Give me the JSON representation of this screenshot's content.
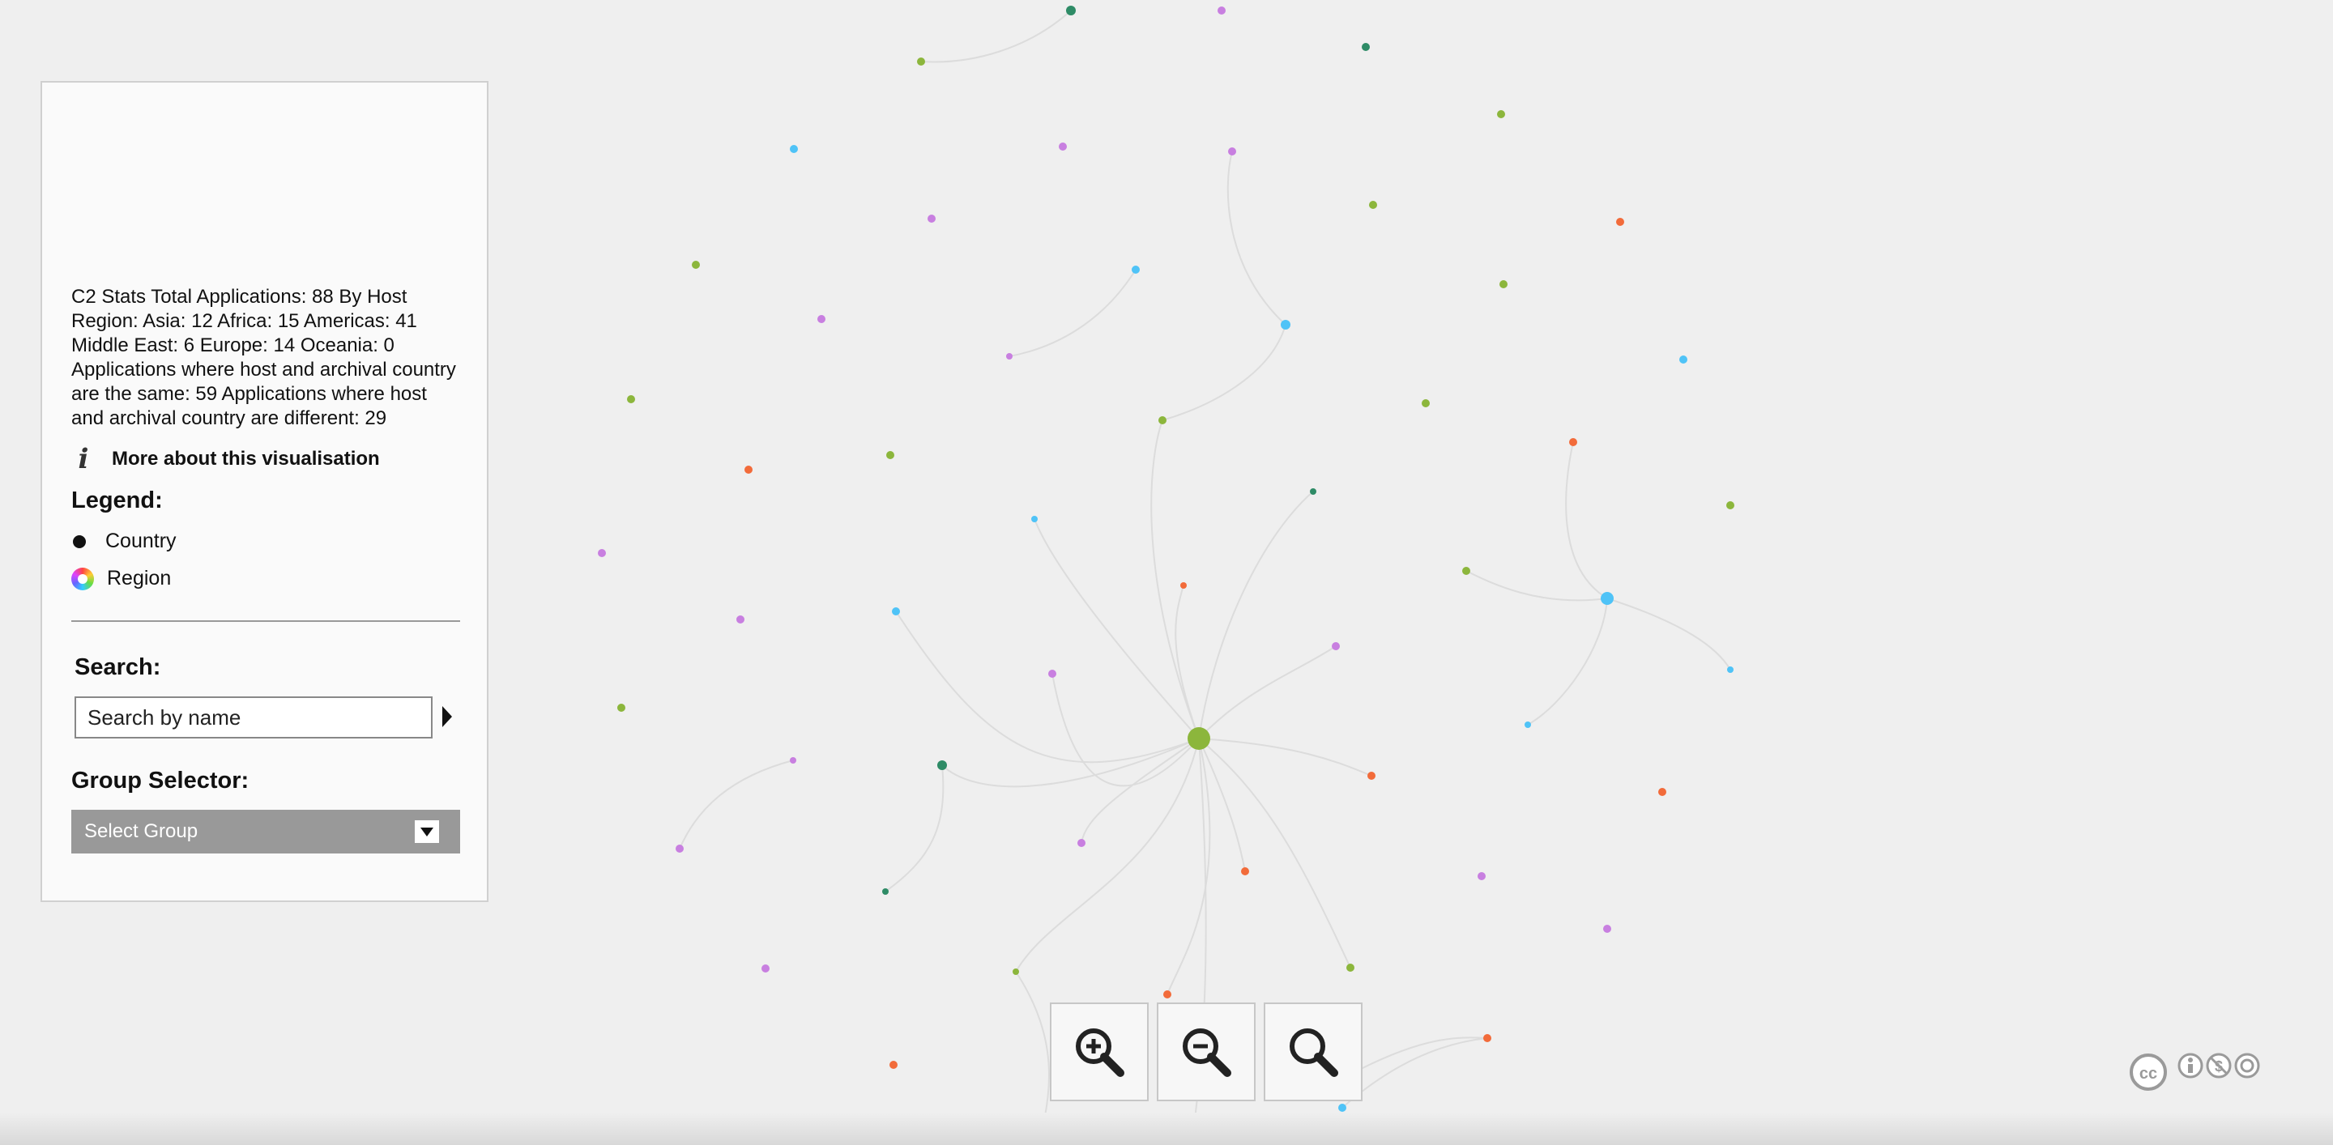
{
  "panel": {
    "stats_text": "C2 Stats Total Applications: 88 By Host Region: Asia: 12 Africa: 15 Americas: 41 Middle East: 6 Europe: 14 Oceania: 0 Applications where host and archival country are the same: 59 Applications where host and archival country are different: 29",
    "about_label": "More about this visualisation",
    "legend_title": "Legend:",
    "legend": {
      "country_label": "Country",
      "region_label": "Region"
    },
    "search_title": "Search:",
    "search_placeholder": "Search by name",
    "group_title": "Group Selector:",
    "group_select_label": "Select Group"
  },
  "icons": {
    "info": "info-icon",
    "search_submit": "play-arrow-icon",
    "dropdown": "chevron-down-icon",
    "zoom_in": "zoom-in-icon",
    "zoom_out": "zoom-out-icon",
    "zoom_reset": "zoom-reset-icon",
    "license": "creative-commons-icon"
  },
  "colors": {
    "background": "#efefef",
    "panel_background": "#fafafa",
    "group_select_background": "#999999",
    "node_green": "#8cb63c",
    "node_dark_green": "#2e8b66",
    "node_blue": "#4fc3f7",
    "node_purple": "#c87fe0",
    "node_orange": "#f26b3a",
    "edge": "#dcdcdc"
  }
}
